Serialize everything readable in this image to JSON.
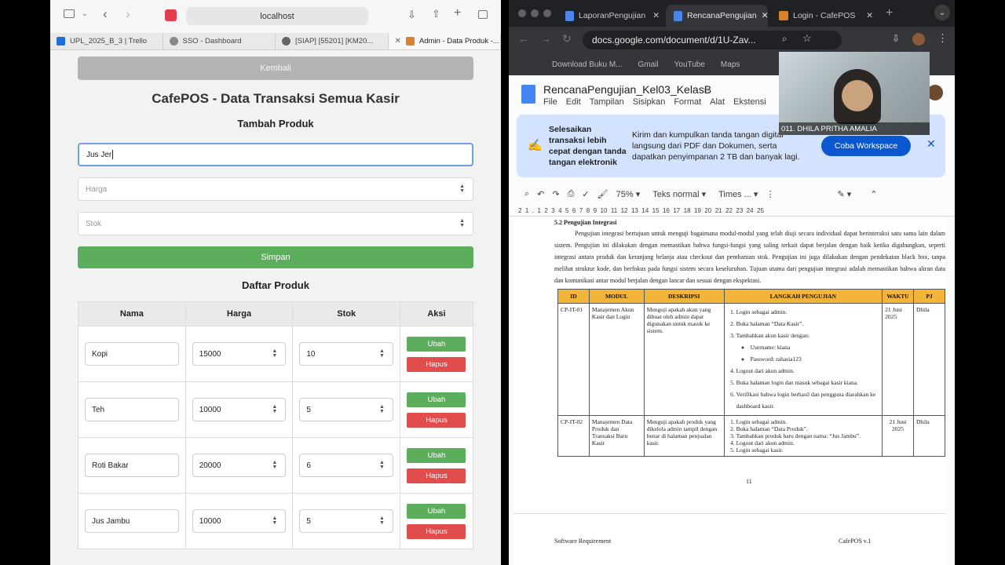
{
  "safari": {
    "url": "localhost",
    "tabs": [
      "UPL_2025_B_3 | Trello",
      "SSO - Dashboard",
      "[SIAP] [55201] [KM20...",
      "Admin - Data Produk -..."
    ]
  },
  "app": {
    "back_label": "Kembali",
    "title": "CafePOS - Data Transaksi Semua Kasir",
    "add_title": "Tambah Produk",
    "name_value": "Jus Jer",
    "price_placeholder": "Harga",
    "stock_placeholder": "Stok",
    "save_label": "Simpan",
    "list_title": "Daftar Produk",
    "columns": [
      "Nama",
      "Harga",
      "Stok",
      "Aksi"
    ],
    "rows": [
      {
        "nama": "Kopi",
        "harga": "15000",
        "stok": "10"
      },
      {
        "nama": "Teh",
        "harga": "10000",
        "stok": "5"
      },
      {
        "nama": "Roti Bakar",
        "harga": "20000",
        "stok": "6"
      },
      {
        "nama": "Jus Jambu",
        "harga": "10000",
        "stok": "5"
      }
    ],
    "edit_label": "Ubah",
    "delete_label": "Hapus"
  },
  "chrome": {
    "tabs": [
      "LaporanPengujian",
      "RencanaPengujian",
      "Login - CafePOS"
    ],
    "url": "docs.google.com/document/d/1U-Zav...",
    "bookmarks": [
      "Download Buku M...",
      "Gmail",
      "YouTube",
      "Maps"
    ]
  },
  "docs": {
    "title": "RencanaPengujian_Kel03_KelasB",
    "menus": [
      "File",
      "Edit",
      "Tampilan",
      "Sisipkan",
      "Format",
      "Alat",
      "Ekstensi"
    ],
    "banner_bold": "Selesaikan transaksi lebih cepat dengan tanda tangan elektronik",
    "banner_text": "Kirim dan kumpulkan tanda tangan digital langsung dari PDF dan Dokumen, serta dapatkan penyimpanan 2 TB dan banyak lagi.",
    "banner_button": "Coba Workspace",
    "zoom": "75%",
    "style": "Teks normal",
    "font": "Times ...",
    "ruler": "2  1  .  1  2  3  4  5  6  7  8  9  10  11  12  13  14  15  16  17  18  19  20  21  22  23  24  25",
    "section": "5.2 Pengujian Integrasi",
    "paragraph": "Pengujian integrasi bertujuan untuk menguji bagaimana modul-modul yang telah diuji secara individual dapat berinteraksi satu sama lain dalam sistem. Pengujian ini dilakukan dengan memastikan bahwa fungsi-fungsi yang saling terkait dapat berjalan dengan baik ketika digabungkan, seperti integrasi antara produk dan keranjang belanja atau checkout dan pembaruan stok. Pengujian ini juga dilakukan dengan pendekatan black box, tanpa melihat struktur kode, dan berfokus pada fungsi sistem secara keseluruhan. Tujuan utama dari pengujian integrasi adalah memastikan bahwa aliran data dan komunikasi antar modul berjalan dengan lancar dan sesuai dengan ekspektasi.",
    "table_headers": [
      "ID",
      "MODUL",
      "DESKRIPSI",
      "LANGKAH PENGUJIAN",
      "WAKTU",
      "PJ"
    ],
    "rows": [
      {
        "id": "CP-IT-01",
        "modul": "Manajemen Akun Kasir dan Login",
        "desc": "Menguji apakah akun yang dibuat oleh admin dapat digunakan untuk masuk ke sistem.",
        "steps": [
          "Login sebagai admin.",
          "Buka halaman “Data Kasir”.",
          "Tambahkan akun kasir dengan:",
          "Logout dari akun admin.",
          "Buka halaman login dan masuk sebagai kasir kiana.",
          "Verifikasi bahwa login berhasil dan pengguna diarahkan ke dashboard kasir."
        ],
        "sub": [
          "Username: kiana",
          "Password: rahasia123"
        ],
        "waktu": "21 Juni 2025",
        "pj": "Dhila"
      },
      {
        "id": "CP-IT-02",
        "modul": "Manajemen Data Produk dan Transaksi Baru Kasir",
        "desc": "Menguji apakah produk yang dikelola admin tampil dengan benar di halaman penjualan kasir.",
        "steps": [
          "Login sebagai admin.",
          "Buka halaman “Data Produk”.",
          "Tambahkan produk baru dengan nama: “Jus Jambu”.",
          "Logout dari akun admin.",
          "Login sebagai kasir."
        ],
        "waktu": "21 Juni 2025",
        "pj": "Dhila"
      }
    ],
    "page_number": "11",
    "footer_left": "Software Requirement",
    "footer_right": "CafePOS v.1"
  },
  "webcam": {
    "name": "011. DHILA PRITHA AMALIA"
  }
}
